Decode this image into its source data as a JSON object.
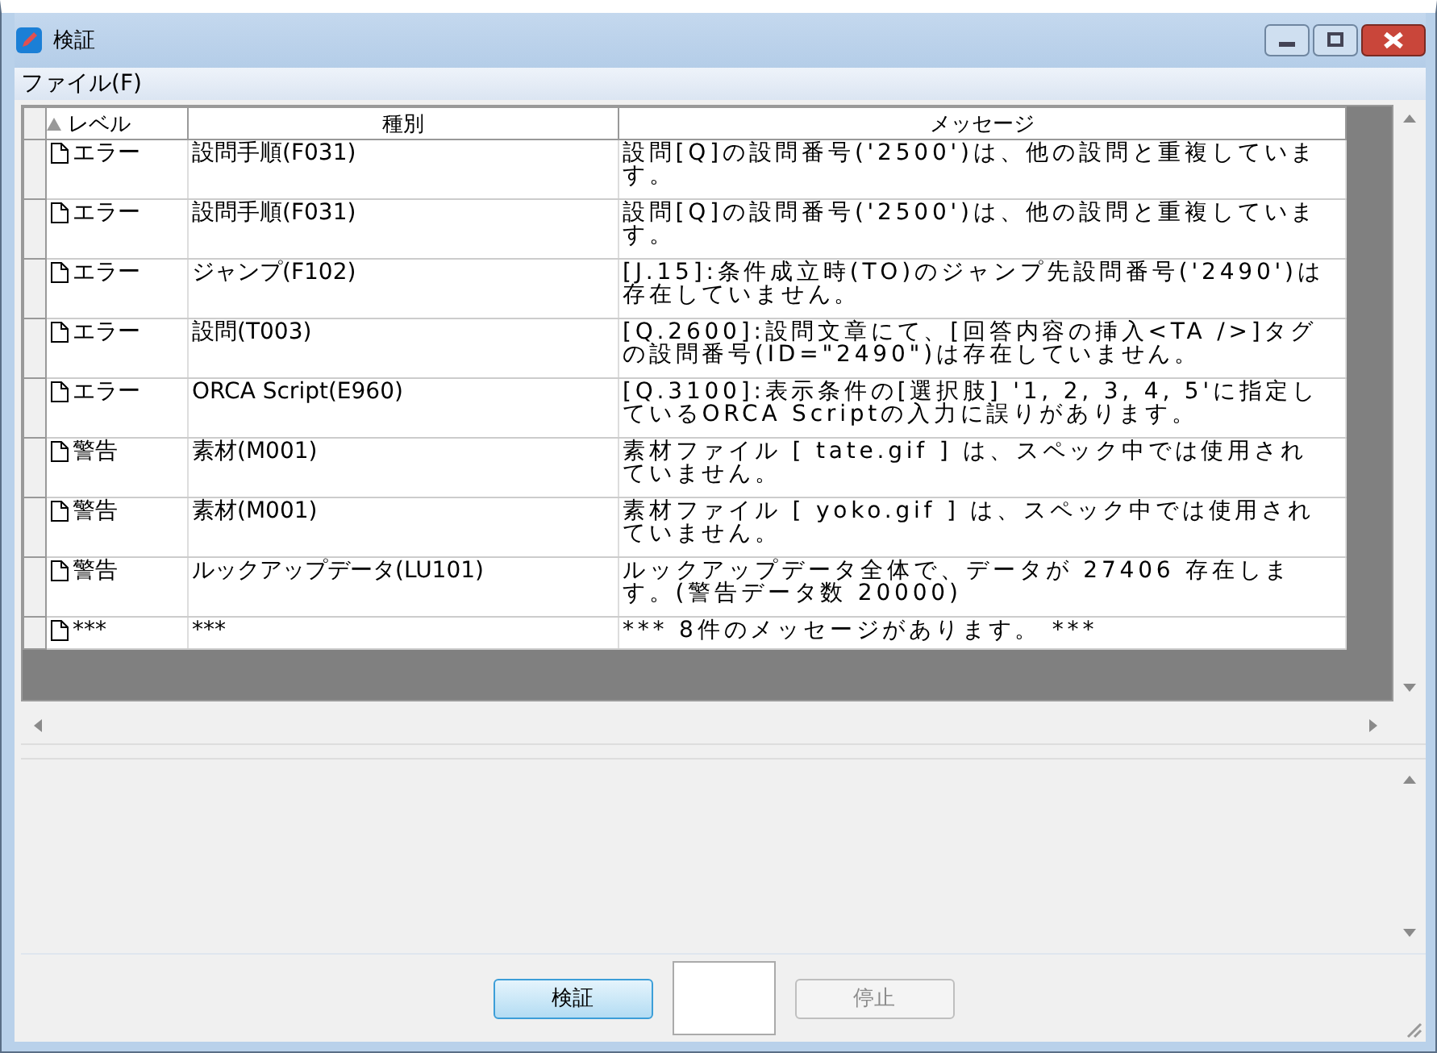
{
  "window": {
    "title": "検証"
  },
  "menu": [
    {
      "label": "ファイル(F)"
    }
  ],
  "table": {
    "columns": [
      {
        "label": "レベル",
        "sorted": true
      },
      {
        "label": "種別",
        "sorted": false
      },
      {
        "label": "メッセージ",
        "sorted": false
      }
    ],
    "rows": [
      {
        "level": "エラー",
        "type": "設問手順(F031)",
        "message": "設問[Q]の設問番号('2500')は、他の設問と重複しています。"
      },
      {
        "level": "エラー",
        "type": "設問手順(F031)",
        "message": "設問[Q]の設問番号('2500')は、他の設問と重複しています。"
      },
      {
        "level": "エラー",
        "type": "ジャンプ(F102)",
        "message": "[J.15]:条件成立時(TO)のジャンプ先設問番号('2490')は存在していません。"
      },
      {
        "level": "エラー",
        "type": "設問(T003)",
        "message": "[Q.2600]:設問文章にて、[回答内容の挿入<TA />]タグの設問番号(ID=\"2490\")は存在していません。"
      },
      {
        "level": "エラー",
        "type": "ORCA Script(E960)",
        "message": "[Q.3100]:表示条件の[選択肢] '1, 2, 3, 4, 5'に指定しているORCA Scriptの入力に誤りがあります。"
      },
      {
        "level": "警告",
        "type": "素材(M001)",
        "message": "素材ファイル [ tate.gif ] は、スペック中では使用されていません。"
      },
      {
        "level": "警告",
        "type": "素材(M001)",
        "message": "素材ファイル [ yoko.gif ] は、スペック中では使用されていません。"
      },
      {
        "level": "警告",
        "type": "ルックアップデータ(LU101)",
        "message": "ルックアップデータ全体で、データが 27406 存在します。(警告データ数 20000)"
      },
      {
        "level": "***",
        "type": "***",
        "message": "*** 8件のメッセージがあります。 ***"
      }
    ]
  },
  "buttons": [
    {
      "label": "検証",
      "kind": "default",
      "disabled": false
    },
    {
      "kind": "blank"
    },
    {
      "label": "停止",
      "kind": "normal",
      "disabled": true
    }
  ]
}
